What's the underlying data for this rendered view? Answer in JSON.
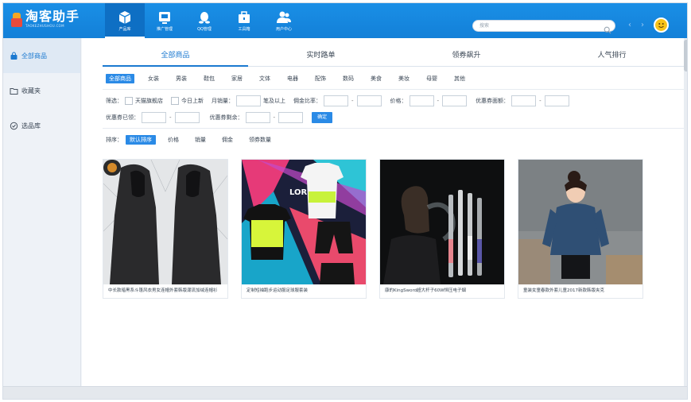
{
  "app": {
    "logo_title": "淘客助手",
    "logo_sub": "TAOKEZHUSHOU.COM"
  },
  "nav": [
    {
      "label": "产品库",
      "icon": "box-icon"
    },
    {
      "label": "推广管理",
      "icon": "monitor-icon"
    },
    {
      "label": "QQ管理",
      "icon": "qq-icon"
    },
    {
      "label": "工具箱",
      "icon": "toolbox-icon"
    },
    {
      "label": "用户中心",
      "icon": "users-icon"
    }
  ],
  "search": {
    "placeholder": "搜索"
  },
  "sidebar": {
    "items": [
      {
        "label": "全部商品",
        "icon": "shopping-bag-icon"
      },
      {
        "label": "收藏夹",
        "icon": "folder-icon"
      },
      {
        "label": "选品库",
        "icon": "library-icon"
      }
    ]
  },
  "tabs": [
    "全部商品",
    "实时路单",
    "领券飙升",
    "人气排行"
  ],
  "categories": [
    "全部商品",
    "女装",
    "男装",
    "鞋包",
    "家居",
    "文体",
    "电器",
    "配饰",
    "数码",
    "美食",
    "美妆",
    "母婴",
    "其他"
  ],
  "filters": {
    "label": "筛选：",
    "tmall": "天猫旗舰店",
    "today_new": "今日上新",
    "monthly_sales": "月销量：",
    "above": "笔及以上",
    "commission_rate": "佣金比率：",
    "price": "价格：",
    "coupon_amount": "优惠券面额：",
    "coupon_received": "优惠券已领：",
    "coupon_remaining": "优惠券剩余：",
    "confirm": "确定"
  },
  "sort": {
    "label": "排序：",
    "options": [
      "默认排序",
      "价格",
      "销量",
      "佣金",
      "领券数量"
    ]
  },
  "products": [
    {
      "title": "中长款暗黑系斗篷风衣男女连帽外套韩版潮流加绒连帽衫"
    },
    {
      "title": "定制短袖跑步运动服足球服套装"
    },
    {
      "title": "康的KingSword超大杆子60W恒压电子烟"
    },
    {
      "title": "童装女童春款外套儿童2017新款韩版夹克"
    }
  ],
  "colors": {
    "accent": "#1b79d0",
    "topbar": "#1a8fe6",
    "button": "#2a8ae6"
  }
}
